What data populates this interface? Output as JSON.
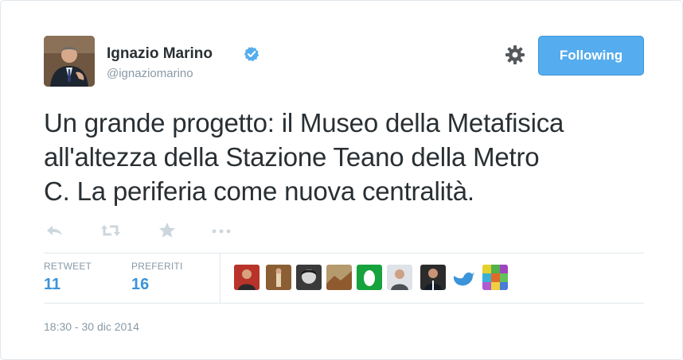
{
  "user": {
    "name": "Ignazio Marino",
    "handle": "@ignaziomarino",
    "verified": true
  },
  "follow_button": {
    "label": "Following"
  },
  "settings": {
    "icon": "gear-icon"
  },
  "tweet": {
    "text_line1": "Un grande progetto: il Museo della Metafisica",
    "text_line2": "all'altezza della Stazione Teano della Metro",
    "text_line3": "C. La periferia come nuova centralità."
  },
  "actions": [
    {
      "icon": "reply-icon"
    },
    {
      "icon": "retweet-icon"
    },
    {
      "icon": "star-icon"
    },
    {
      "icon": "more-icon"
    }
  ],
  "stats": {
    "retweet_label": "RETWEET",
    "retweet_count": "11",
    "favorites_label": "PREFERITI",
    "favorites_count": "16"
  },
  "timestamp": "18:30 - 30 dic 2014",
  "colors": {
    "accent": "#55acee",
    "link_blue": "#3b94d9",
    "muted": "#8899a6",
    "text": "#292f33",
    "border": "#e1e8ed"
  }
}
